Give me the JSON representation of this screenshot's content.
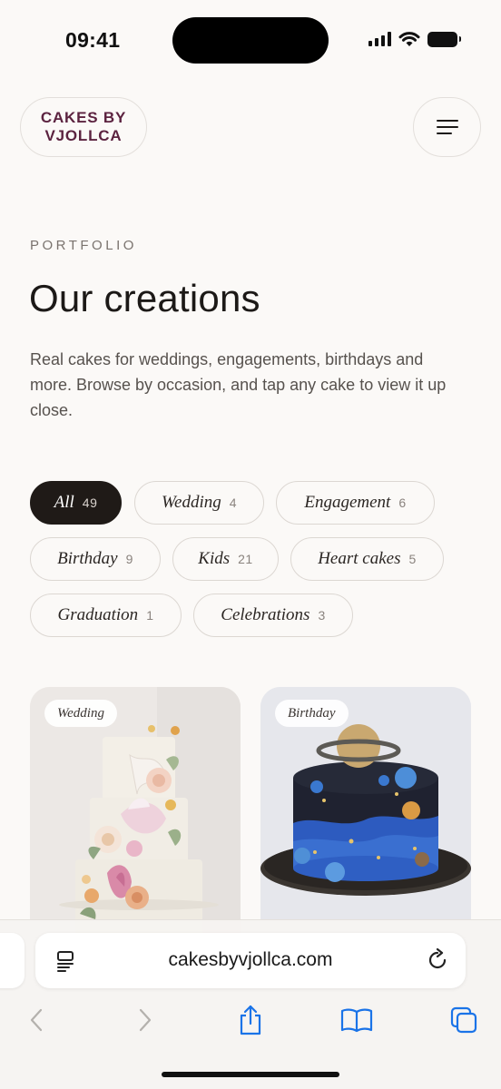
{
  "status_bar": {
    "time": "09:41"
  },
  "header": {
    "logo_line1": "CAKES BY",
    "logo_line2": "VJOLLCA",
    "menu_icon": "hamburger-icon"
  },
  "hero": {
    "eyebrow": "PORTFOLIO",
    "title": "Our creations",
    "intro": "Real cakes for weddings, engagements, birthdays and more. Browse by occasion, and tap any cake to view it up close."
  },
  "filters": [
    {
      "label": "All",
      "count": "49",
      "active": true
    },
    {
      "label": "Wedding",
      "count": "4",
      "active": false
    },
    {
      "label": "Engagement",
      "count": "6",
      "active": false
    },
    {
      "label": "Birthday",
      "count": "9",
      "active": false
    },
    {
      "label": "Kids",
      "count": "21",
      "active": false
    },
    {
      "label": "Heart cakes",
      "count": "5",
      "active": false
    },
    {
      "label": "Graduation",
      "count": "1",
      "active": false
    },
    {
      "label": "Celebrations",
      "count": "3",
      "active": false
    }
  ],
  "cards": [
    {
      "tag": "Wedding",
      "image": "white-tiered-floral-wedding-cake"
    },
    {
      "tag": "Birthday",
      "image": "space-planets-birthday-cake"
    }
  ],
  "browser": {
    "url": "cakesbyvjollca.com",
    "icons": [
      "reader-icon",
      "reload-icon",
      "back-icon",
      "forward-icon",
      "share-icon",
      "bookmarks-icon",
      "tabs-icon"
    ]
  },
  "colors": {
    "background": "#fbf9f7",
    "logo": "#5c2340",
    "active_chip": "#1f1a17",
    "text": "#1c1917"
  }
}
